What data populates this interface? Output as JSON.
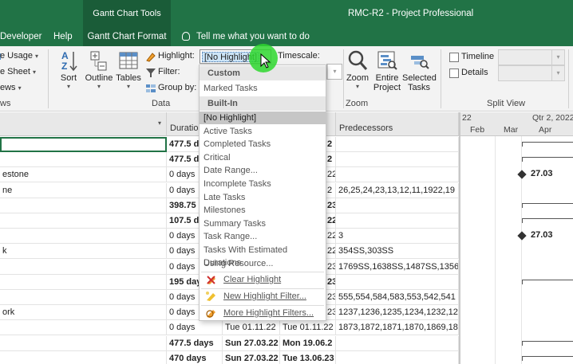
{
  "titlebar": {
    "context_tab_group": "Gantt Chart Tools",
    "window_title": "RMC-R2  -  Project Professional"
  },
  "tabs": {
    "developer": "Developer",
    "help": "Help",
    "gantt_chart_format": "Gantt Chart Format",
    "tell_me": "Tell me what you want to do"
  },
  "ribbon": {
    "resource_usage": "e Usage",
    "resource_sheet": "e Sheet",
    "other_views": "ews",
    "views_group": "ws",
    "sort": "Sort",
    "outline": "Outline",
    "tables": "Tables",
    "highlight_label": "Highlight:",
    "highlight_value": "[No Highlight]",
    "filter_label": "Filter:",
    "group_by_label": "Group by:",
    "data_group": "Data",
    "timescale_label": "Timescale:",
    "zoom": "Zoom",
    "entire_project": [
      "Entire",
      "Project"
    ],
    "selected_tasks": [
      "Selected",
      "Tasks"
    ],
    "zoom_group": "Zoom",
    "timeline": "Timeline",
    "details": "Details",
    "split_view_group": "Split View"
  },
  "highlight_menu": {
    "custom_header": "Custom",
    "custom_items": [
      "Marked Tasks"
    ],
    "builtin_header": "Built-In",
    "builtin_items": [
      "[No Highlight]",
      "Active Tasks",
      "Completed Tasks",
      "Critical",
      "Date Range...",
      "Incomplete Tasks",
      "Late Tasks",
      "Milestones",
      "Summary Tasks",
      "Task Range...",
      "Tasks With Estimated Durations",
      "Using Resource..."
    ],
    "selected_item": "[No Highlight]",
    "actions": [
      "Clear Highlight",
      "New Highlight Filter...",
      "More Highlight Filters..."
    ]
  },
  "grid": {
    "columns": {
      "duration": "Duration",
      "predecessors": "Predecessors"
    },
    "rows": [
      {
        "name": "",
        "duration": "477.5 days",
        "start": "",
        "finish": "2",
        "pred": "",
        "bold": true
      },
      {
        "name": "",
        "duration": "477.5 days",
        "start": "",
        "finish": "2",
        "pred": "",
        "bold": true
      },
      {
        "name": "estone",
        "duration": "0 days",
        "start": "",
        "finish": "22",
        "pred": "",
        "bold": false
      },
      {
        "name": "ne",
        "duration": "0 days",
        "start": "",
        "finish": "2",
        "pred": "26,25,24,23,13,12,11,1922,19",
        "bold": false
      },
      {
        "name": "",
        "duration": "398.75 days",
        "start": "",
        "finish": "23",
        "pred": "",
        "bold": true
      },
      {
        "name": "",
        "duration": "107.5 days",
        "start": "",
        "finish": "22",
        "pred": "",
        "bold": true
      },
      {
        "name": "",
        "duration": "0 days",
        "start": "",
        "finish": "22",
        "pred": "3",
        "bold": false
      },
      {
        "name": "k",
        "duration": "0 days",
        "start": "",
        "finish": "22",
        "pred": "354SS,303SS",
        "bold": false
      },
      {
        "name": "",
        "duration": "0 days",
        "start": "",
        "finish": "23",
        "pred": "1769SS,1638SS,1487SS,1356S",
        "bold": false
      },
      {
        "name": "",
        "duration": "195 days",
        "start": "",
        "finish": "23",
        "pred": "",
        "bold": true
      },
      {
        "name": "",
        "duration": "0 days",
        "start": "",
        "finish": "23",
        "pred": "555,554,584,583,553,542,541",
        "bold": false
      },
      {
        "name": "ork",
        "duration": "0 days",
        "start": "",
        "finish": "23",
        "pred": "1237,1236,1235,1234,1232,12",
        "bold": false
      },
      {
        "name": "",
        "duration": "0 days",
        "start": "Tue 01.11.22",
        "finish": "Tue 01.11.22",
        "pred": "1873,1872,1871,1870,1869,18",
        "bold": false
      },
      {
        "name": "",
        "duration": "477.5 days",
        "start": "Sun 27.03.22",
        "finish": "Mon 19.06.2",
        "pred": "",
        "bold": true
      },
      {
        "name": "",
        "duration": "470 days",
        "start": "Sun 27.03.22",
        "finish": "Tue 13.06.23",
        "pred": "",
        "bold": true
      }
    ]
  },
  "timescale": {
    "top": [
      "22",
      "Qtr 2, 2022"
    ],
    "bottom": [
      "Feb",
      "Mar",
      "Apr"
    ]
  },
  "milestones": [
    "27.03",
    "27.03"
  ]
}
